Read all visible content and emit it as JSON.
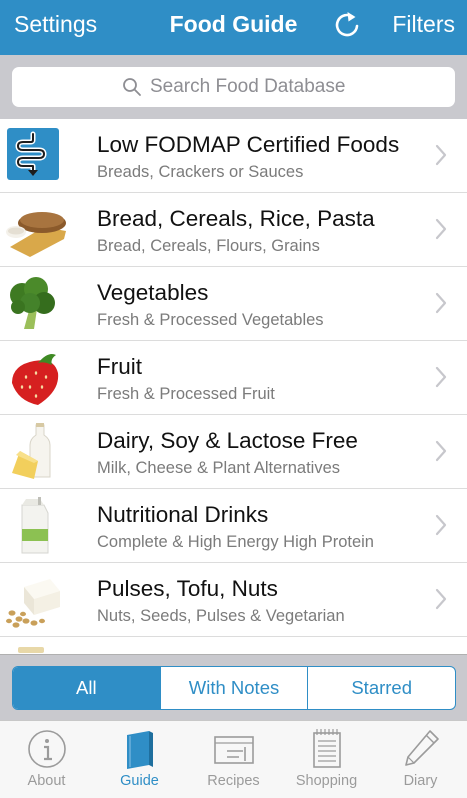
{
  "navbar": {
    "left_label": "Settings",
    "title": "Food Guide",
    "right_label": "Filters"
  },
  "search": {
    "placeholder": "Search Food Database"
  },
  "categories": [
    {
      "title": "Low FODMAP Certified Foods",
      "subtitle": "Breads, Crackers or Sauces",
      "icon": "low-fodmap-certified-logo"
    },
    {
      "title": "Bread, Cereals, Rice, Pasta",
      "subtitle": "Bread, Cereals, Flours, Grains",
      "icon": "bread-icon"
    },
    {
      "title": "Vegetables",
      "subtitle": "Fresh & Processed Vegetables",
      "icon": "broccoli-icon"
    },
    {
      "title": "Fruit",
      "subtitle": "Fresh & Processed Fruit",
      "icon": "strawberry-icon"
    },
    {
      "title": "Dairy, Soy & Lactose Free",
      "subtitle": "Milk, Cheese & Plant Alternatives",
      "icon": "milk-cheese-icon"
    },
    {
      "title": "Nutritional Drinks",
      "subtitle": "Complete & High Energy High Protein",
      "icon": "drink-carton-icon"
    },
    {
      "title": "Pulses, Tofu, Nuts",
      "subtitle": "Nuts, Seeds, Pulses & Vegetarian",
      "icon": "tofu-nuts-icon"
    }
  ],
  "filter_segments": {
    "items": [
      "All",
      "With Notes",
      "Starred"
    ],
    "selected": "All"
  },
  "tabbar": {
    "items": [
      {
        "label": "About",
        "icon": "info-icon"
      },
      {
        "label": "Guide",
        "icon": "book-icon"
      },
      {
        "label": "Recipes",
        "icon": "recipe-card-icon"
      },
      {
        "label": "Shopping",
        "icon": "notepad-icon"
      },
      {
        "label": "Diary",
        "icon": "pencil-icon"
      }
    ],
    "selected": "Guide"
  },
  "colors": {
    "accent": "#2f8ec6",
    "navbar_bg": "#2f8ec6",
    "search_bar_bg": "#c9c9ce",
    "secondary_text": "#7b7b7b",
    "tab_inactive": "#9b9b9b"
  }
}
